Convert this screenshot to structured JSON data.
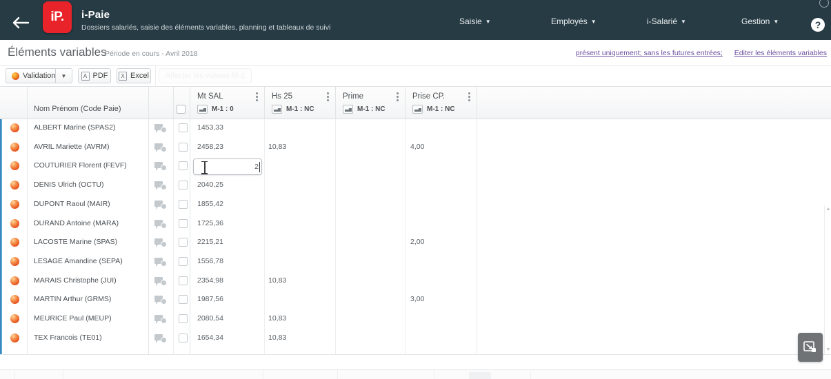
{
  "header": {
    "back_icon": "back-arrow-icon",
    "logo_text": "iP.",
    "app_title": "i-Paie",
    "app_subtitle": "Dossiers salariés, saisie des éléments variables, planning et tableaux de suivi",
    "nav": [
      {
        "label": "Saisie",
        "caret": "▼"
      },
      {
        "label": "Employés",
        "caret": "▼"
      },
      {
        "label": "i-Salarié",
        "caret": "▼"
      },
      {
        "label": "Gestion",
        "caret": "▼"
      }
    ],
    "help_label": "?"
  },
  "page": {
    "title": "Éléments variables",
    "period": "Période en cours - Avril 2018",
    "links": [
      {
        "label": "présent uniquement; sans les futures entrées;"
      },
      {
        "label": "Editer les éléments variables"
      }
    ]
  },
  "toolbar": {
    "validation_label": "Validation",
    "validation_caret": "▼",
    "pdf_label": "PDF",
    "pdf_icon_glyph": "A",
    "excel_label": "Excel",
    "excel_icon_glyph": "X",
    "assign_label": "Affecter les valeurs M-1"
  },
  "grid": {
    "name_column_header": "Nom Prénom (Code Paie)",
    "kebab_icon": "kebab-menu-icon",
    "columns": [
      {
        "title": "Mt SAL",
        "sub": "M-1 : 0"
      },
      {
        "title": "Hs 25",
        "sub": "M-1 : NC"
      },
      {
        "title": "Prime",
        "sub": "M-1 : NC"
      },
      {
        "title": "Prise CP.",
        "sub": "M-1 : NC"
      }
    ],
    "rows": [
      {
        "name": "ALBERT Marine (SPAS2)",
        "mt_sal": "1453,33",
        "hs25": "",
        "prime": "",
        "prise_cp": ""
      },
      {
        "name": "AVRIL Mariette (AVRM)",
        "mt_sal": "2458,23",
        "hs25": "10,83",
        "prime": "",
        "prise_cp": "4,00"
      },
      {
        "name": "COUTURIER Florent (FEVF)",
        "mt_sal": "2",
        "hs25": "",
        "prime": "",
        "prise_cp": "",
        "editing": true
      },
      {
        "name": "DENIS Ulrich (OCTU)",
        "mt_sal": "2040,25",
        "hs25": "",
        "prime": "",
        "prise_cp": ""
      },
      {
        "name": "DUPONT Raoul (MAIR)",
        "mt_sal": "1855,42",
        "hs25": "",
        "prime": "",
        "prise_cp": ""
      },
      {
        "name": "DURAND Antoine (MARA)",
        "mt_sal": "1725,36",
        "hs25": "",
        "prime": "",
        "prise_cp": ""
      },
      {
        "name": "LACOSTE Marine (SPAS)",
        "mt_sal": "2215,21",
        "hs25": "",
        "prime": "",
        "prise_cp": "2,00"
      },
      {
        "name": "LESAGE Amandine (SEPA)",
        "mt_sal": "1556,78",
        "hs25": "",
        "prime": "",
        "prise_cp": ""
      },
      {
        "name": "MARAIS Christophe (JUI)",
        "mt_sal": "2354,98",
        "hs25": "10,83",
        "prime": "",
        "prise_cp": ""
      },
      {
        "name": "MARTIN Arthur (GRMS)",
        "mt_sal": "1987,56",
        "hs25": "",
        "prime": "",
        "prise_cp": "3,00"
      },
      {
        "name": "MEURICE Paul (MEUP)",
        "mt_sal": "2080,54",
        "hs25": "10,83",
        "prime": "",
        "prise_cp": ""
      },
      {
        "name": "TEX Francois (TE01)",
        "mt_sal": "1654,34",
        "hs25": "10,83",
        "prime": "",
        "prise_cp": ""
      }
    ]
  },
  "scrollbar": {
    "up_glyph": "▲",
    "down_glyph": "▼"
  },
  "panel_button": {
    "icon": "expand-panel-icon"
  },
  "colors": {
    "header_bg": "#273b44",
    "logo_red": "#e8242a",
    "link_purple": "#6b4fa0",
    "status_orange": "#e9561f",
    "accent_blue": "#5ba3d0"
  }
}
